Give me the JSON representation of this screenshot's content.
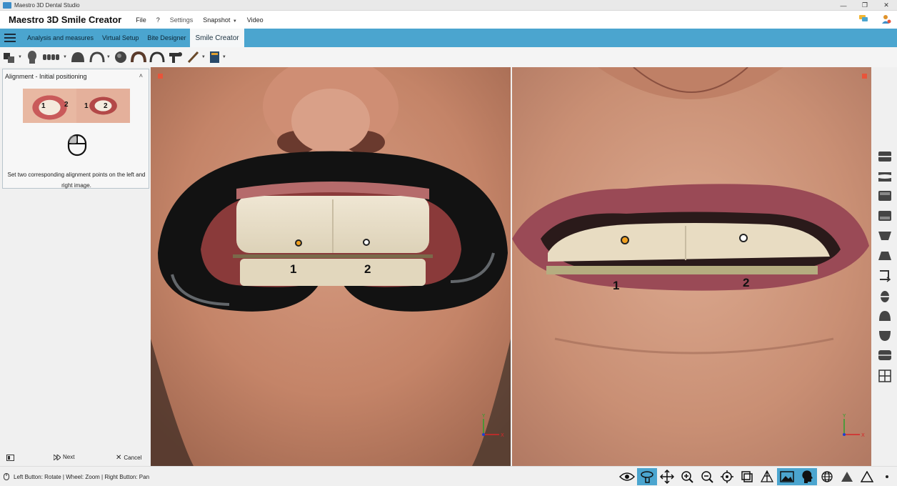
{
  "window": {
    "title": "Maestro 3D Dental Studio",
    "controls": [
      "—",
      "❐",
      "✕"
    ]
  },
  "menubar": {
    "app_title": "Maestro 3D Smile Creator",
    "items": [
      "File",
      "?",
      "Settings",
      "Snapshot",
      "Video"
    ]
  },
  "ribbon": {
    "tabs": [
      "Analysis and measures",
      "Virtual Setup",
      "Bite Designer",
      "Smile Creator"
    ],
    "active_tab": "Smile Creator"
  },
  "left_panel": {
    "header": "Alignment - Initial positioning",
    "thumb_left_labels": [
      "1",
      "2"
    ],
    "thumb_right_labels": [
      "1",
      "2"
    ],
    "instruction": "Set two corresponding alignment points on the left and right image.",
    "next_label": "Next",
    "cancel_label": "Cancel"
  },
  "viewports": {
    "left_points": [
      "1",
      "2"
    ],
    "right_points": [
      "1",
      "2"
    ]
  },
  "statusbar": {
    "hint": "Left Button: Rotate | Wheel: Zoom | Right Button: Pan"
  },
  "colors": {
    "accent": "#4ba5cf",
    "close": "#e8543a",
    "point_orange": "#f0a020"
  }
}
